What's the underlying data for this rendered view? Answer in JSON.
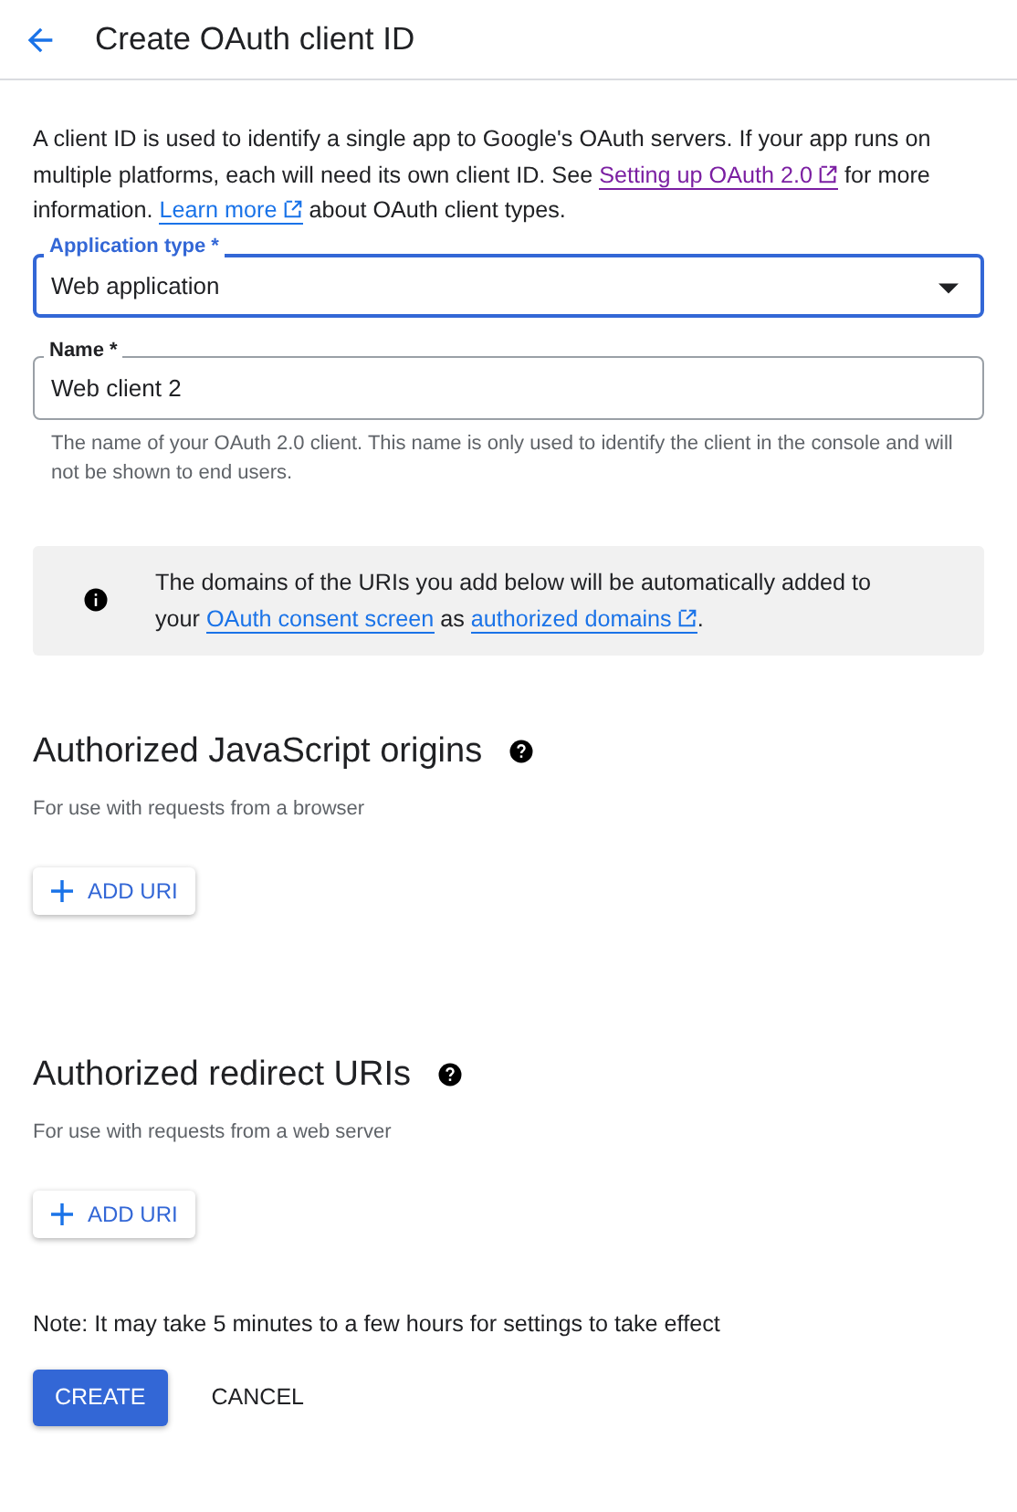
{
  "header": {
    "title": "Create OAuth client ID"
  },
  "intro": [
    {
      "kind": "text",
      "text": "A client ID is used to identify a single app to Google's OAuth servers. If your app runs on multiple platforms, each will need its own client ID. See "
    },
    {
      "kind": "link",
      "text": "Setting up OAuth 2.0",
      "visited": true,
      "external": true
    },
    {
      "kind": "text",
      "text": " for more information. "
    },
    {
      "kind": "link",
      "text": "Learn more",
      "visited": false,
      "external": true
    },
    {
      "kind": "text",
      "text": " about OAuth client types."
    }
  ],
  "application_type": {
    "label": "Application type *",
    "value": "Web application",
    "focused": true
  },
  "name_field": {
    "label": "Name *",
    "value": "Web client 2",
    "focused": false,
    "helper": "The name of your OAuth 2.0 client. This name is only used to identify the client in the console and will not be shown to end users."
  },
  "info": [
    {
      "kind": "text",
      "text": "The domains of the URIs you add below will be automatically added to your "
    },
    {
      "kind": "link",
      "text": "OAuth consent screen",
      "visited": false,
      "external": false
    },
    {
      "kind": "text",
      "text": " as "
    },
    {
      "kind": "link",
      "text": "authorized domains",
      "visited": false,
      "external": true
    },
    {
      "kind": "text",
      "text": "."
    }
  ],
  "sections": [
    {
      "title": "Authorized JavaScript origins",
      "subtitle": "For use with requests from a browser",
      "button": "ADD URI"
    },
    {
      "title": "Authorized redirect URIs",
      "subtitle": "For use with requests from a web server",
      "button": "ADD URI"
    }
  ],
  "note": "Note: It may take 5 minutes to a few hours for settings to take effect",
  "actions": [
    {
      "label": "CREATE",
      "kind": "primary"
    },
    {
      "label": "CANCEL",
      "kind": "text"
    }
  ]
}
